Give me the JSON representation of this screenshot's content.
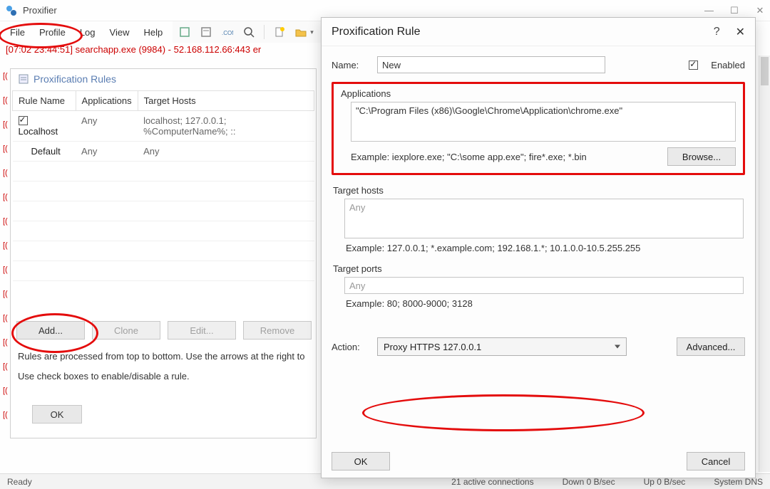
{
  "main_window": {
    "title": "Proxifier",
    "menu": {
      "items": [
        "File",
        "Profile",
        "Log",
        "View",
        "Help"
      ]
    },
    "logline": "[07:02 23:44:51] searchapp.exe (9984) - 52.168.112.66:443 er",
    "panel": {
      "title": "Proxification Rules",
      "columns": [
        "Rule Name",
        "Applications",
        "Target Hosts"
      ],
      "rows": [
        {
          "checked": true,
          "name": "Localhost",
          "apps": "Any",
          "hosts": "localhost; 127.0.0.1; %ComputerName%; ::"
        },
        {
          "checked": false,
          "name": "Default",
          "apps": "Any",
          "hosts": "Any"
        }
      ],
      "buttons": {
        "add": "Add...",
        "clone": "Clone",
        "edit": "Edit...",
        "remove": "Remove"
      },
      "help1": "Rules are processed from top to bottom. Use the arrows at the right to",
      "help2": "Use check boxes to enable/disable a rule.",
      "ok": "OK"
    },
    "statusbar": {
      "ready": "Ready",
      "conns": "21 active connections",
      "down": "Down 0 B/sec",
      "up": "Up 0 B/sec",
      "dns": "System DNS"
    }
  },
  "dialog": {
    "title": "Proxification Rule",
    "name_label": "Name:",
    "name_value": "New",
    "enabled_label": "Enabled",
    "apps_label": "Applications",
    "apps_value": "\"C:\\Program Files (x86)\\Google\\Chrome\\Application\\chrome.exe\"",
    "apps_example": "Example: iexplore.exe; \"C:\\some app.exe\"; fire*.exe; *.bin",
    "browse": "Browse...",
    "hosts_label": "Target hosts",
    "hosts_value": "Any",
    "hosts_example": "Example: 127.0.0.1; *.example.com; 192.168.1.*; 10.1.0.0-10.5.255.255",
    "ports_label": "Target ports",
    "ports_value": "Any",
    "ports_example": "Example: 80; 8000-9000; 3128",
    "action_label": "Action:",
    "action_value": "Proxy HTTPS 127.0.0.1",
    "advanced": "Advanced...",
    "ok": "OK",
    "cancel": "Cancel"
  }
}
